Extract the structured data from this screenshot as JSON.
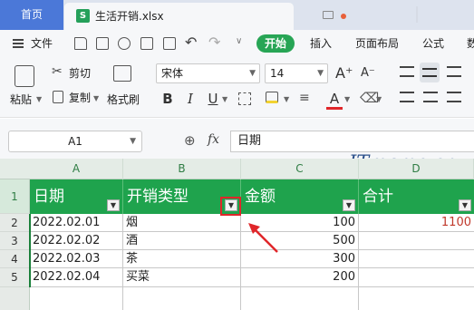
{
  "tabs": {
    "home": "首页",
    "file_icon": "S",
    "file_name": "生活开销.xlsx"
  },
  "menubar": {
    "file_label": "文件",
    "start_button": "开始",
    "insert": "插入",
    "page_layout": "页面布局",
    "formula": "公式",
    "data_partial": "数"
  },
  "ribbon": {
    "paste": "粘贴",
    "cut": "剪切",
    "copy": "复制",
    "format_painter": "格式刷",
    "font_name": "宋体",
    "font_size": "14",
    "bold": "B",
    "italic": "I",
    "underline": "U",
    "font_color_letter": "A",
    "font_color": "#e0262a",
    "grow_font": "A⁺",
    "shrink_font": "A⁻"
  },
  "formula_bar": {
    "name_box": "A1",
    "zoom_icon": "⊕",
    "fx": "fx",
    "value": "日期"
  },
  "watermark": "ITmemo.cn",
  "sheet": {
    "columns": [
      "A",
      "B",
      "C",
      "D"
    ],
    "rows": [
      "1",
      "2",
      "3",
      "4",
      "5"
    ],
    "header": [
      "日期",
      "开销类型",
      "金额",
      "合计"
    ],
    "data": [
      [
        "2022.02.01",
        "烟",
        "100",
        "1100"
      ],
      [
        "2022.02.02",
        "酒",
        "500",
        ""
      ],
      [
        "2022.02.03",
        "茶",
        "300",
        ""
      ],
      [
        "2022.02.04",
        "买菜",
        "200",
        ""
      ]
    ],
    "header_fill": "#1fa34d",
    "total_color": "#c0392b"
  }
}
